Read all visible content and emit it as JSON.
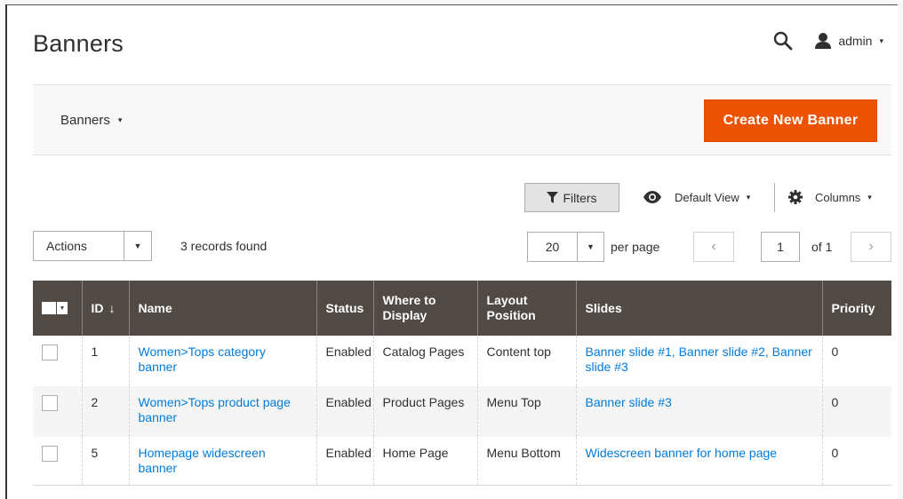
{
  "header": {
    "title": "Banners",
    "admin_label": "admin",
    "admin_caret": "▾"
  },
  "page_actions": {
    "store_switcher": "Banners",
    "store_caret": "▾",
    "create_button": "Create New Banner"
  },
  "toolbar": {
    "filters_label": "Filters",
    "default_view_label": "Default View",
    "columns_label": "Columns",
    "caret": "▾"
  },
  "grid_controls": {
    "actions_label": "Actions",
    "records_found": "3 records found",
    "per_page_value": "20",
    "per_page_label": "per page",
    "current_page": "1",
    "page_total": "of 1",
    "prev_symbol": "‹",
    "next_symbol": "›"
  },
  "table": {
    "headers": {
      "id": "ID",
      "sort_arrow": "↓",
      "name": "Name",
      "status": "Status",
      "where_to_display": "Where to Display",
      "layout_position": "Layout Position",
      "slides": "Slides",
      "priority": "Priority"
    },
    "rows": [
      {
        "id": "1",
        "name": "Women>Tops category banner",
        "status": "Enabled",
        "where": "Catalog Pages",
        "position": "Content top",
        "slides": "Banner slide #1, Banner slide #2, Banner slide #3",
        "priority": "0"
      },
      {
        "id": "2",
        "name": "Women>Tops product page banner",
        "status": "Enabled",
        "where": "Product Pages",
        "position": "Menu Top",
        "slides": "Banner slide #3",
        "priority": "0"
      },
      {
        "id": "5",
        "name": "Homepage widescreen banner",
        "status": "Enabled",
        "where": "Home Page",
        "position": "Menu Bottom",
        "slides": "Widescreen banner for home page",
        "priority": "0"
      }
    ]
  },
  "colors": {
    "accent": "#eb5202",
    "table_header": "#514943",
    "link": "#007bdb"
  }
}
